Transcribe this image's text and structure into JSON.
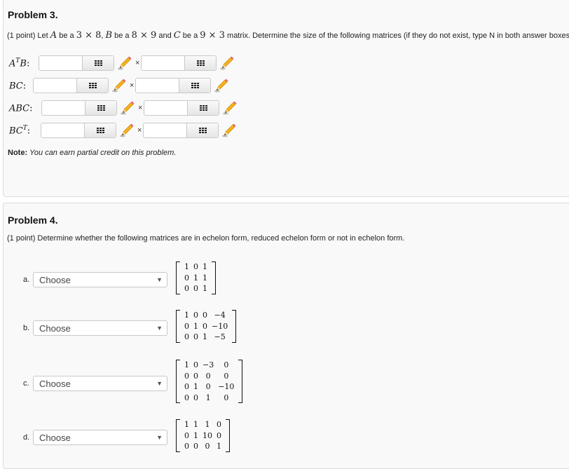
{
  "problem3": {
    "title": "Problem 3.",
    "description_parts": {
      "prefix": "(1 point) Let ",
      "A": "A",
      "be_a1": " be a ",
      "dimA": "3 × 8",
      "sep1": ", ",
      "B": "B",
      "be_a2": " be a ",
      "dimB": "8 × 9",
      "and": " and ",
      "C": "C",
      "be_a3": " be a ",
      "dimC": "9 × 3",
      "suffix": " matrix. Determine the size of the following matrices (if they do not exist, type N in both answer boxes):"
    },
    "rows": [
      {
        "label_base": "A",
        "label_sup": "T",
        "label_tail": "B",
        "colon": ":",
        "rows_value": "",
        "cols_value": ""
      },
      {
        "label_base": "BC",
        "label_sup": "",
        "label_tail": "",
        "colon": ":",
        "rows_value": "",
        "cols_value": ""
      },
      {
        "label_base": "ABC",
        "label_sup": "",
        "label_tail": "",
        "colon": ":",
        "rows_value": "",
        "cols_value": ""
      },
      {
        "label_base": "BC",
        "label_sup": "T",
        "label_tail": "",
        "colon": ":",
        "rows_value": "",
        "cols_value": ""
      }
    ],
    "times_symbol": "×",
    "note_label": "Note:",
    "note_text": "You can earn partial credit on this problem."
  },
  "problem4": {
    "title": "Problem 4.",
    "description": "(1 point) Determine whether the following matrices are in echelon form, reduced echelon form or not in echelon form.",
    "items": [
      {
        "letter": "a.",
        "selected": "Choose",
        "matrix": [
          [
            "1",
            "0",
            "1"
          ],
          [
            "0",
            "1",
            "1"
          ],
          [
            "0",
            "0",
            "1"
          ]
        ]
      },
      {
        "letter": "b.",
        "selected": "Choose",
        "matrix": [
          [
            "1",
            "0",
            "0",
            "−4"
          ],
          [
            "0",
            "1",
            "0",
            "−10"
          ],
          [
            "0",
            "0",
            "1",
            "−5"
          ]
        ]
      },
      {
        "letter": "c.",
        "selected": "Choose",
        "matrix": [
          [
            "1",
            "0",
            "−3",
            "0"
          ],
          [
            "0",
            "0",
            "0",
            "0"
          ],
          [
            "0",
            "1",
            "0",
            "−10"
          ],
          [
            "0",
            "0",
            "1",
            "0"
          ]
        ]
      },
      {
        "letter": "d.",
        "selected": "Choose",
        "matrix": [
          [
            "1",
            "1",
            "1",
            "0"
          ],
          [
            "0",
            "1",
            "10",
            "0"
          ],
          [
            "0",
            "0",
            "0",
            "1"
          ]
        ]
      }
    ],
    "dropdown_arrow": "▼"
  }
}
